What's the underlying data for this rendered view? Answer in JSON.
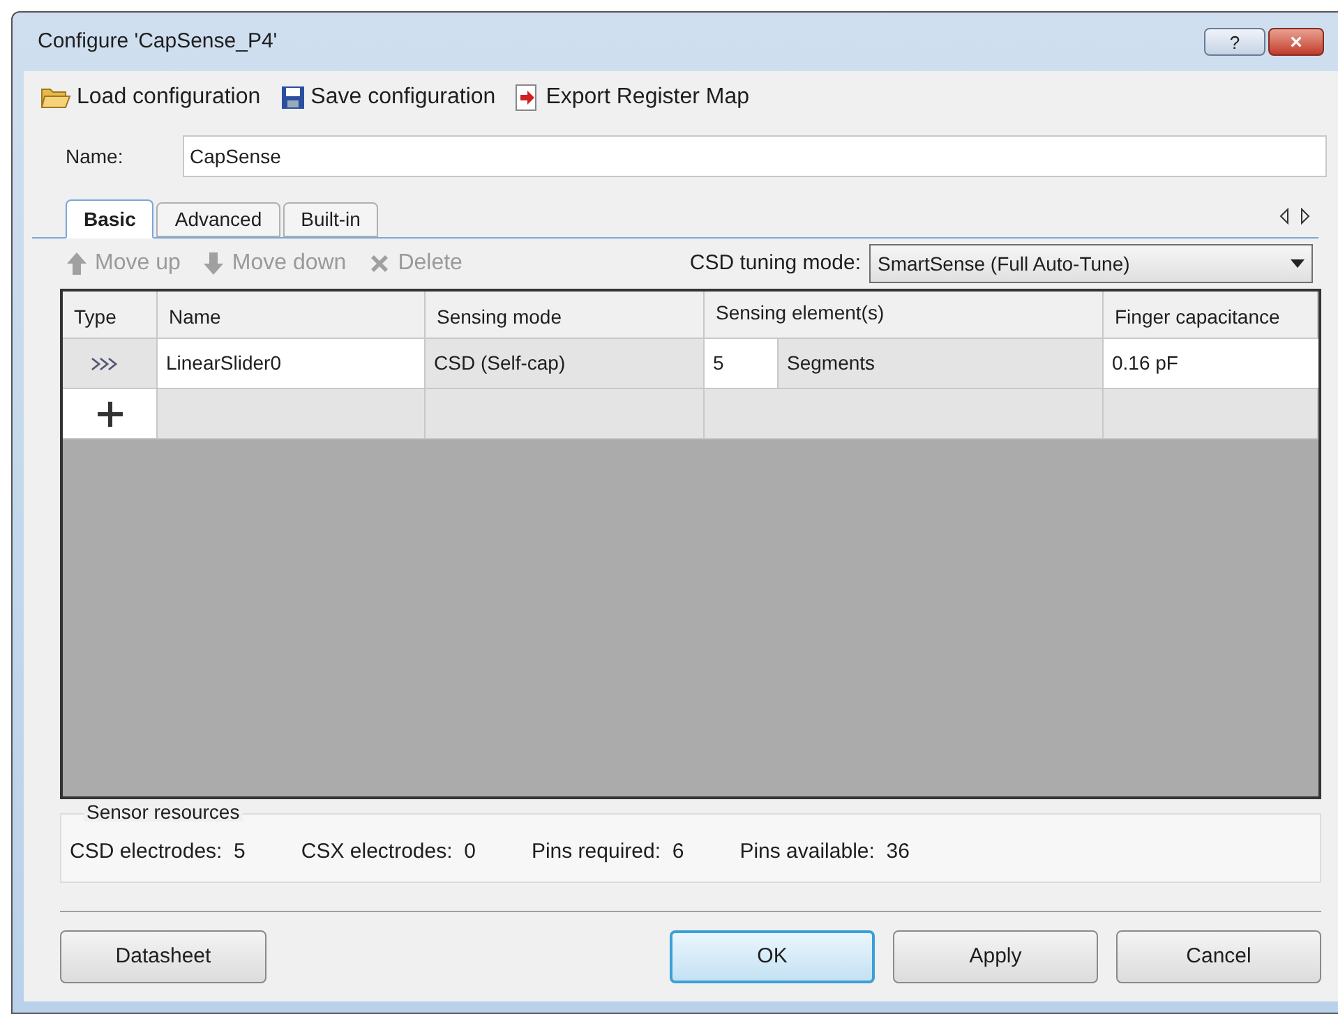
{
  "window": {
    "title": "Configure 'CapSense_P4'",
    "help": "?",
    "close": "×"
  },
  "toolbar": [
    "Load configuration",
    "Save configuration",
    "Export Register Map"
  ],
  "name_field": {
    "label": "Name:",
    "value": "CapSense"
  },
  "tabs": [
    {
      "label": "Basic",
      "selected": true
    },
    {
      "label": "Advanced",
      "selected": false
    },
    {
      "label": "Built-in",
      "selected": false
    }
  ],
  "actions": [
    {
      "label": "Move up",
      "disabled": true
    },
    {
      "label": "Move down",
      "disabled": true
    },
    {
      "label": "Delete",
      "disabled": true
    }
  ],
  "tuning": {
    "label": "CSD tuning mode:",
    "value": "SmartSense (Full Auto-Tune)"
  },
  "table": {
    "columns": [
      "Type",
      "Name",
      "Sensing mode",
      "Sensing element(s)",
      "Finger capacitance"
    ],
    "rows": [
      {
        "name": "LinearSlider0",
        "mode": "CSD (Self-cap)",
        "count": "5",
        "element": "Segments",
        "capacitance": "0.16 pF"
      }
    ]
  },
  "sensor_resources": {
    "title": "Sensor resources",
    "items": [
      {
        "label": "CSD electrodes:",
        "value": "5"
      },
      {
        "label": "CSX electrodes:",
        "value": "0"
      },
      {
        "label": "Pins required:",
        "value": "6"
      },
      {
        "label": "Pins available:",
        "value": "36"
      }
    ]
  },
  "buttons": {
    "left": "Datasheet",
    "right": [
      {
        "label": "OK",
        "default": true
      },
      {
        "label": "Apply",
        "default": false
      },
      {
        "label": "Cancel",
        "default": false
      }
    ]
  }
}
